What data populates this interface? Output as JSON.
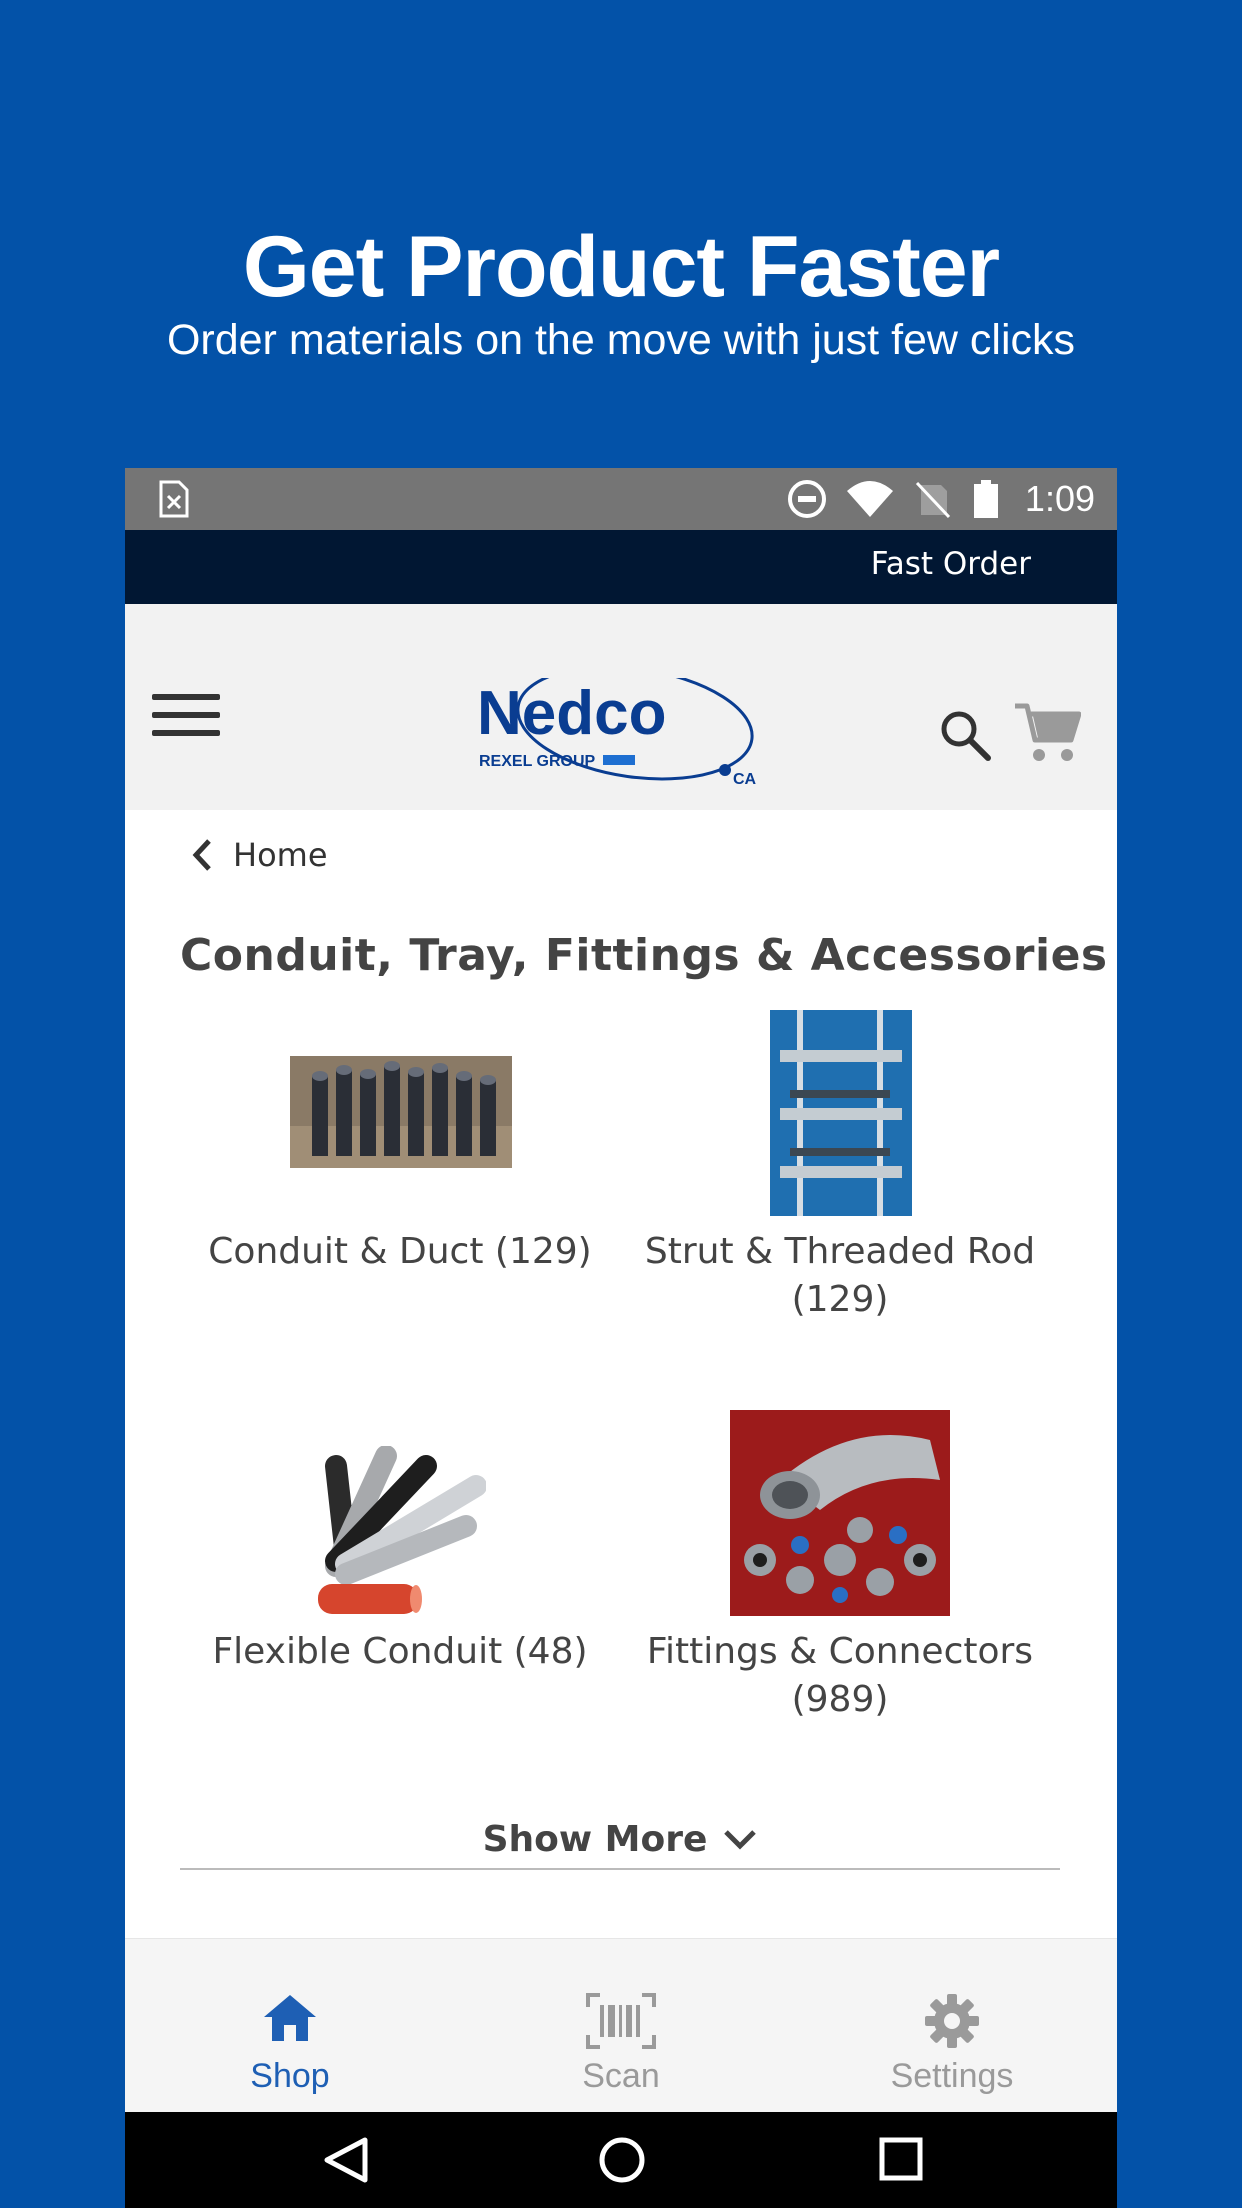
{
  "promo": {
    "title": "Get Product Faster",
    "subtitle": "Order materials on the move with just few clicks",
    "background_color": "#0352a8"
  },
  "status_bar": {
    "time": "1:09",
    "icons": [
      "sim-card-missing-icon",
      "do-not-disturb-icon",
      "wifi-icon",
      "no-signal-icon",
      "battery-icon"
    ]
  },
  "top_bar": {
    "fast_order_label": "Fast Order",
    "color": "#011733"
  },
  "header": {
    "logo_text": "Nedco",
    "logo_subtext": "REXEL GROUP",
    "logo_suffix": "CA",
    "icons": [
      "hamburger-menu-icon",
      "search-icon",
      "cart-icon"
    ]
  },
  "breadcrumb": {
    "back_label": "Home"
  },
  "page": {
    "title": "Conduit, Tray, Fittings & Accessories"
  },
  "categories": [
    {
      "label": "Conduit & Duct (129)",
      "image": "conduit-pipes"
    },
    {
      "label": "Strut & Threaded Rod (129)",
      "image": "strut-rack"
    },
    {
      "label": "Flexible Conduit (48)",
      "image": "flexible-conduit"
    },
    {
      "label": "Fittings & Connectors (989)",
      "image": "fittings"
    }
  ],
  "show_more": {
    "label": "Show More"
  },
  "bottom_nav": {
    "items": [
      {
        "label": "Shop",
        "icon": "home-icon",
        "active": true
      },
      {
        "label": "Scan",
        "icon": "barcode-icon",
        "active": false
      },
      {
        "label": "Settings",
        "icon": "gear-icon",
        "active": false
      }
    ],
    "active_color": "#1e5fb4",
    "inactive_color": "#9a9a9a"
  }
}
